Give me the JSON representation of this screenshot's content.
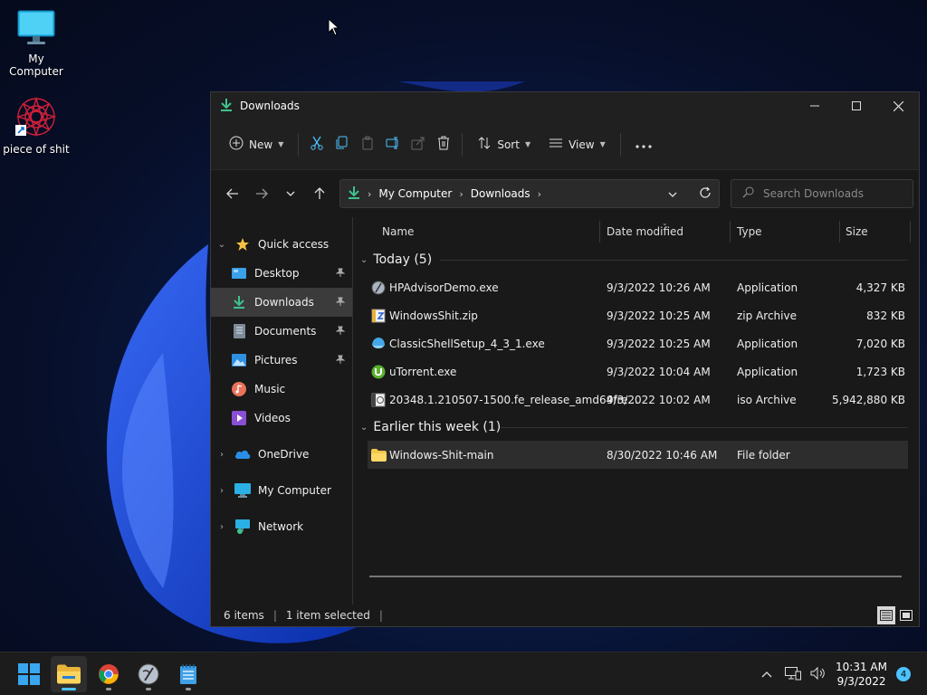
{
  "desktop": {
    "icons": [
      {
        "label": "My Computer",
        "icon": "monitor-icon"
      },
      {
        "label": "piece of shit",
        "icon": "mandala-shortcut-icon"
      }
    ]
  },
  "window": {
    "title": "Downloads",
    "icon": "download-arrow-icon",
    "accent": "#3ec28f"
  },
  "toolbar": {
    "new_label": "New",
    "sort_label": "Sort",
    "view_label": "View"
  },
  "address": {
    "crumbs": [
      "My Computer",
      "Downloads"
    ]
  },
  "search": {
    "placeholder": "Search Downloads"
  },
  "nav": {
    "quick_access": "Quick access",
    "items": [
      {
        "label": "Desktop",
        "pinned": true
      },
      {
        "label": "Downloads",
        "pinned": true,
        "selected": true
      },
      {
        "label": "Documents",
        "pinned": true
      },
      {
        "label": "Pictures",
        "pinned": true
      },
      {
        "label": "Music",
        "pinned": false
      },
      {
        "label": "Videos",
        "pinned": false
      }
    ],
    "onedrive": "OneDrive",
    "my_computer": "My Computer",
    "network": "Network"
  },
  "columns": {
    "name": "Name",
    "date": "Date modified",
    "type": "Type",
    "size": "Size"
  },
  "groups": [
    {
      "label": "Today (5)",
      "rows": [
        {
          "name": "HPAdvisorDemo.exe",
          "date": "9/3/2022 10:26 AM",
          "type": "Application",
          "size": "4,327 KB",
          "icon": "app-exe-icon"
        },
        {
          "name": "WindowsShit.zip",
          "date": "9/3/2022 10:25 AM",
          "type": "zip Archive",
          "size": "832 KB",
          "icon": "zip-archive-icon"
        },
        {
          "name": "ClassicShellSetup_4_3_1.exe",
          "date": "9/3/2022 10:25 AM",
          "type": "Application",
          "size": "7,020 KB",
          "icon": "shell-installer-icon"
        },
        {
          "name": "uTorrent.exe",
          "date": "9/3/2022 10:04 AM",
          "type": "Application",
          "size": "1,723 KB",
          "icon": "utorrent-icon"
        },
        {
          "name": "20348.1.210507-1500.fe_release_amd64fre...",
          "date": "9/3/2022 10:02 AM",
          "type": "iso Archive",
          "size": "5,942,880 KB",
          "icon": "iso-archive-icon"
        }
      ]
    },
    {
      "label": "Earlier this week (1)",
      "rows": [
        {
          "name": "Windows-Shit-main",
          "date": "8/30/2022 10:46 AM",
          "type": "File folder",
          "size": "",
          "icon": "folder-icon",
          "selected": true
        }
      ]
    }
  ],
  "status": {
    "count": "6 items",
    "selected": "1 item selected"
  },
  "taskbar": {
    "time": "10:31 AM",
    "date": "9/3/2022",
    "notifications": "4"
  }
}
